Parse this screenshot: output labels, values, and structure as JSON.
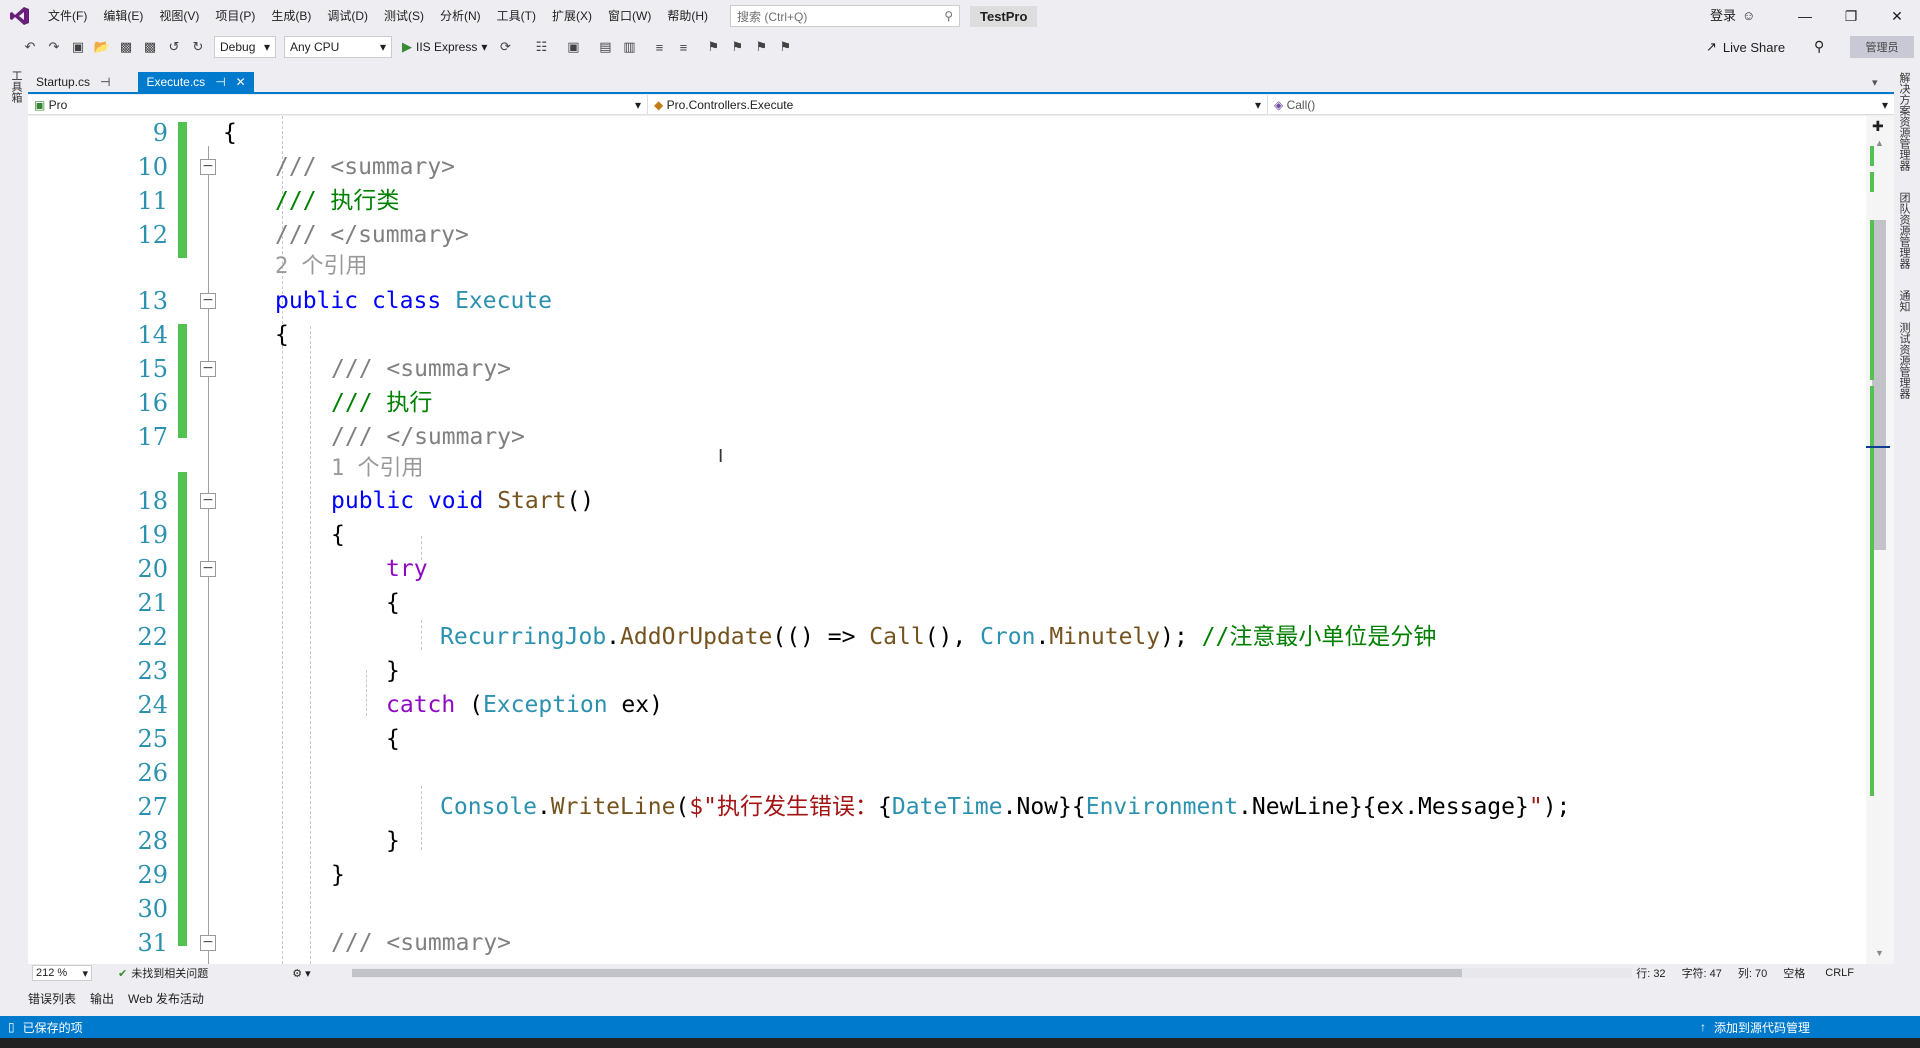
{
  "menubar": {
    "items": [
      "文件(F)",
      "编辑(E)",
      "视图(V)",
      "项目(P)",
      "生成(B)",
      "调试(D)",
      "测试(S)",
      "分析(N)",
      "工具(T)",
      "扩展(X)",
      "窗口(W)",
      "帮助(H)"
    ],
    "search_placeholder": "搜索 (Ctrl+Q)",
    "solution_name": "TestPro",
    "login": "登录"
  },
  "toolbar": {
    "config": "Debug",
    "platform": "Any CPU",
    "run_label": "IIS Express",
    "live_share": "Live Share",
    "admin": "管理员"
  },
  "sidebars": {
    "left": [
      "工具箱"
    ],
    "right": [
      "解决方案资源管理器",
      "团队资源管理器",
      "通知",
      "测试资源管理器"
    ]
  },
  "tabs": [
    {
      "label": "Startup.cs",
      "pin": "⊣",
      "active": false
    },
    {
      "label": "Execute.cs",
      "pin": "⊣",
      "active": true
    }
  ],
  "navbar": {
    "project": "Pro",
    "type": "Pro.Controllers.Execute",
    "member": "Call()"
  },
  "code_lines": [
    {
      "num": "9",
      "text": "{"
    },
    {
      "num": "10",
      "text": "/// <summary>"
    },
    {
      "num": "11",
      "text": "/// 执行类"
    },
    {
      "num": "12",
      "text": "/// </summary>"
    },
    {
      "num": "",
      "text": "2 个引用"
    },
    {
      "num": "13",
      "text": "public class Execute"
    },
    {
      "num": "14",
      "text": "{"
    },
    {
      "num": "15",
      "text": "/// <summary>"
    },
    {
      "num": "16",
      "text": "/// 执行"
    },
    {
      "num": "17",
      "text": "/// </summary>"
    },
    {
      "num": "",
      "text": "1 个引用"
    },
    {
      "num": "18",
      "text": "public void Start()"
    },
    {
      "num": "19",
      "text": "{"
    },
    {
      "num": "20",
      "text": "try"
    },
    {
      "num": "21",
      "text": "{"
    },
    {
      "num": "22",
      "text": "RecurringJob.AddOrUpdate(() => Call(), Cron.Minutely); //注意最小单位是分钟"
    },
    {
      "num": "23",
      "text": "}"
    },
    {
      "num": "24",
      "text": "catch (Exception ex)"
    },
    {
      "num": "25",
      "text": "{"
    },
    {
      "num": "26",
      "text": ""
    },
    {
      "num": "27",
      "text": "Console.WriteLine($\"执行发生错误：{DateTime.Now}{Environment.NewLine}{ex.Message}\");"
    },
    {
      "num": "28",
      "text": "}"
    },
    {
      "num": "29",
      "text": "}"
    },
    {
      "num": "30",
      "text": ""
    },
    {
      "num": "31",
      "text": "/// <summary>"
    }
  ],
  "editor_status": {
    "zoom": "212 %",
    "issues": "未找到相关问题",
    "row": "行: 32",
    "char": "字符: 47",
    "col": "列: 70",
    "spaces": "空格",
    "eol": "CRLF"
  },
  "panel_tabs": [
    "错误列表",
    "输出",
    "Web 发布活动"
  ],
  "statusbar": {
    "left": "已保存的项",
    "right": "添加到源代码管理"
  }
}
